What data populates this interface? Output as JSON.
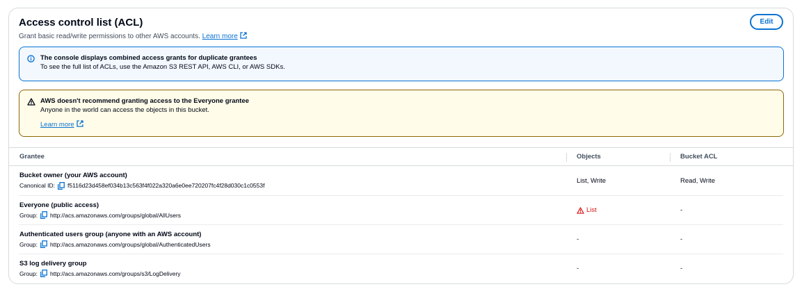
{
  "header": {
    "title": "Access control list (ACL)",
    "subtitle": "Grant basic read/write permissions to other AWS accounts.",
    "learn_more": "Learn more",
    "edit_label": "Edit"
  },
  "info_alert": {
    "title": "The console displays combined access grants for duplicate grantees",
    "body": "To see the full list of ACLs, use the Amazon S3 REST API, AWS CLI, or AWS SDKs."
  },
  "warn_alert": {
    "title": "AWS doesn't recommend granting access to the Everyone grantee",
    "body": "Anyone in the world can access the objects in this bucket.",
    "learn_more": "Learn more"
  },
  "table": {
    "columns": [
      "Grantee",
      "Objects",
      "Bucket ACL"
    ],
    "rows": [
      {
        "grantee": "Bucket owner (your AWS account)",
        "id_label": "Canonical ID:",
        "id_value": "f5116d23d458ef034b13c563f4f022a320a6e0ee720207fc4f28d030c1c0553f",
        "objects": "List, Write",
        "bucket_acl": "Read, Write"
      },
      {
        "grantee": "Everyone (public access)",
        "id_label": "Group:",
        "id_value": "http://acs.amazonaws.com/groups/global/AllUsers",
        "objects": "List",
        "bucket_acl": "-"
      },
      {
        "grantee": "Authenticated users group (anyone with an AWS account)",
        "id_label": "Group:",
        "id_value": "http://acs.amazonaws.com/groups/global/AuthenticatedUsers",
        "objects": "-",
        "bucket_acl": "-"
      },
      {
        "grantee": "S3 log delivery group",
        "id_label": "Group:",
        "id_value": "http://acs.amazonaws.com/groups/s3/LogDelivery",
        "objects": "-",
        "bucket_acl": "-"
      }
    ]
  },
  "colors": {
    "link": "#0972d3",
    "info_border": "#0972d3",
    "warn_border": "#8d6605",
    "error": "#d91515"
  }
}
